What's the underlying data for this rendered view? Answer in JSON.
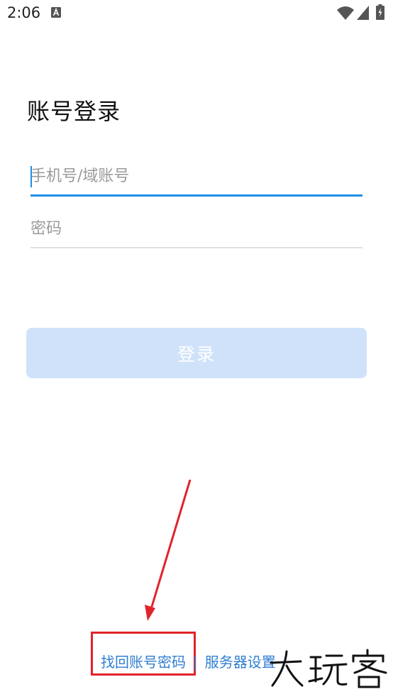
{
  "status_bar": {
    "time": "2:06"
  },
  "login": {
    "title": "账号登录",
    "phone_placeholder": "手机号/域账号",
    "password_placeholder": "密码",
    "login_button": "登录"
  },
  "footer": {
    "find_account_link": "找回账号密码",
    "separator": "|",
    "server_settings_link": "服务器设置"
  },
  "colors": {
    "accent": "#1f8fe5",
    "button_disabled_bg": "#cfe2fa",
    "link": "#2f7fd0",
    "annotation": "#e0232b"
  },
  "watermark": {
    "text": "大玩客"
  }
}
